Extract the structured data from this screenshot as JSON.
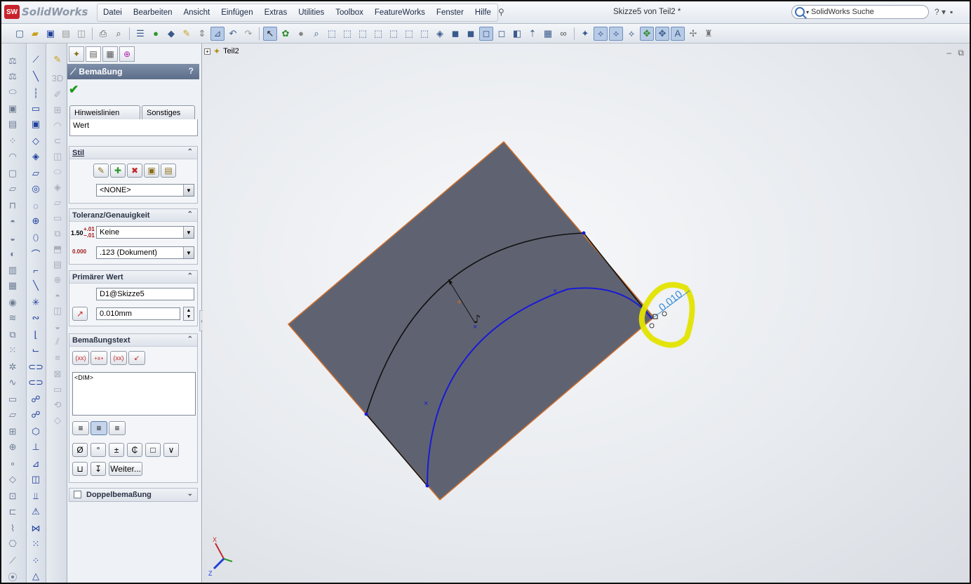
{
  "app": {
    "logo_mark": "SW",
    "logo_text": "SolidWorks",
    "document_title": "Skizze5 von Teil2 *"
  },
  "menu": {
    "items": [
      "Datei",
      "Bearbeiten",
      "Ansicht",
      "Einfügen",
      "Extras",
      "Utilities",
      "Toolbox",
      "FeatureWorks",
      "Fenster",
      "Hilfe"
    ]
  },
  "search": {
    "placeholder": "SolidWorks Suche"
  },
  "help_symbol": "?",
  "window_symbol": "▪",
  "property_manager": {
    "title": "Bemaßung",
    "help": "?",
    "tabs": {
      "leaders": "Hinweislinien",
      "other": "Sonstiges",
      "value": "Wert"
    },
    "style": {
      "heading": "Stil",
      "selected": "<NONE>"
    },
    "tolerance": {
      "heading": "Toleranz/Genauigkeit",
      "tolerance_label": "1.50",
      "tolerance_plus": "+.01",
      "tolerance_minus": "−.01",
      "tolerance_type": "Keine",
      "precision_label": "0.000",
      "precision_value": ".123 (Dokument)"
    },
    "primary_value": {
      "heading": "Primärer Wert",
      "name": "D1@Skizze5",
      "value": "0.010mm"
    },
    "dimension_text": {
      "heading": "Bemaßungstext",
      "buttons": [
        "(xx)",
        "+x+",
        "(xx)",
        "↙"
      ],
      "content": "<DIM>",
      "symbols": [
        "Ø",
        "°",
        "±",
        "₵",
        "□",
        "∨"
      ],
      "more_label": "Weiter..."
    },
    "dual_dimension": {
      "heading": "Doppelbemaßung",
      "checked": false
    }
  },
  "feature_tree": {
    "root": "Teil2"
  },
  "graphics": {
    "dimension_value": "0.010",
    "axis_x": "X",
    "axis_z": "Z",
    "colors": {
      "face": "#5f6371",
      "edge": "#d06d2a",
      "sketch_arc": "#1a1ad8",
      "dimension_text": "#3b8ed8",
      "highlight": "#e3e300"
    }
  }
}
